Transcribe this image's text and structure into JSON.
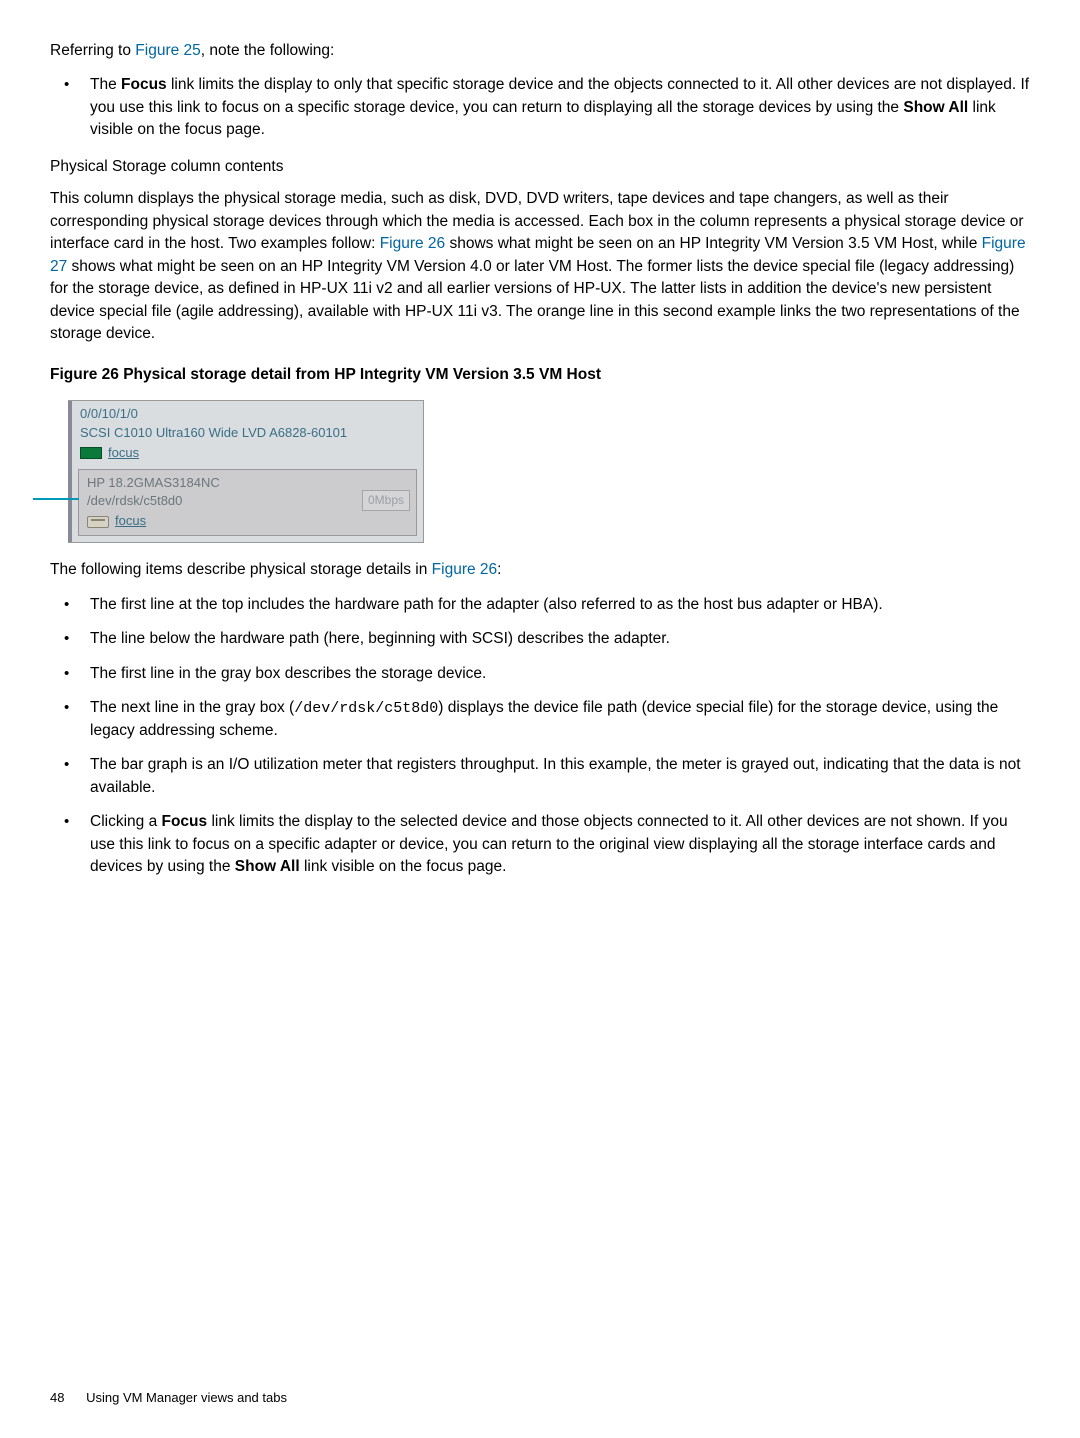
{
  "para1": {
    "pre": "Referring to ",
    "link": "Figure 25",
    "post": ", note the following:"
  },
  "bullet_focus": {
    "pre": "The ",
    "b1": "Focus",
    "mid": " link limits the display to only that specific storage device and the objects connected to it. All other devices are not displayed. If you use this link to focus on a specific storage device, you can return to displaying all the storage devices by using the ",
    "b2": "Show All",
    "post": " link visible on the focus page."
  },
  "subhead": "Physical Storage column contents",
  "para2": {
    "a": "This column displays the physical storage media, such as disk, DVD, DVD writers, tape devices and tape changers, as well as their corresponding physical storage devices through which the media is accessed. Each box in the column represents a physical storage device or interface card in the host. Two examples follow: ",
    "link1": "Figure 26",
    "b": " shows what might be seen on an HP Integrity VM Version 3.5 VM Host, while ",
    "link2": "Figure 27",
    "c": " shows what might be seen on an HP Integrity VM Version 4.0 or later VM Host. The former lists the device special file (legacy addressing) for the storage device, as defined in HP-UX 11i v2 and all earlier versions of HP-UX. The latter lists in addition the device's new persistent device special file (agile addressing), available with HP-UX 11i v3. The orange line in this second example links the two representations of the storage device."
  },
  "figure_caption": "Figure 26 Physical storage detail from HP Integrity VM Version 3.5 VM Host",
  "figure": {
    "hw_path": "0/0/10/1/0",
    "adapter": "SCSI C1010 Ultra160 Wide LVD A6828-60101",
    "focus1": "focus",
    "device": "HP 18.2GMAS3184NC",
    "dsf": "/dev/rdsk/c5t8d0",
    "mbps": "0Mbps",
    "focus2": "focus"
  },
  "para3": {
    "a": "The following items describe physical storage details in ",
    "link": "Figure 26",
    "b": ":"
  },
  "items": {
    "i1": "The first line at the top includes the hardware path for the adapter (also referred to as the host bus adapter or HBA).",
    "i2": "The line below the hardware path (here, beginning with SCSI) describes the adapter.",
    "i3": "The first line in the gray box describes the storage device.",
    "i4a": "The next line in the gray box (",
    "i4code": "/dev/rdsk/c5t8d0",
    "i4b": ") displays the device file path (device special file) for the storage device, using the legacy addressing scheme.",
    "i5": "The bar graph is an I/O utilization meter that registers throughput. In this example, the meter is grayed out, indicating that the data is not available.",
    "i6a": "Clicking a ",
    "i6b1": "Focus",
    "i6b": " link limits the display to the selected device and those objects connected to it. All other devices are not shown. If you use this link to focus on a specific adapter or device, you can return to the original view displaying all the storage interface cards and devices by using the ",
    "i6b2": "Show All",
    "i6c": " link visible on the focus page."
  },
  "footer": {
    "page": "48",
    "section": "Using VM Manager views and tabs"
  }
}
